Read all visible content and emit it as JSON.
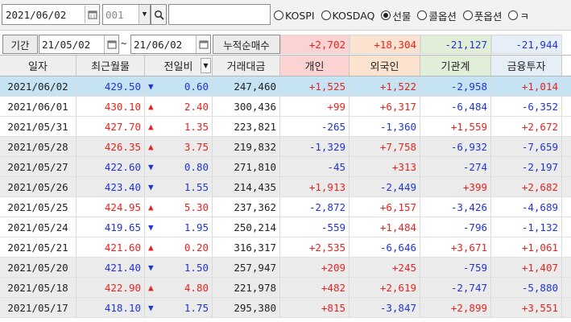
{
  "toolbar": {
    "date": "2021/06/02",
    "code": "001",
    "name": "",
    "radios": [
      {
        "label": "KOSPI",
        "selected": false
      },
      {
        "label": "KOSDAQ",
        "selected": false
      },
      {
        "label": "선물",
        "selected": true
      },
      {
        "label": "콜옵션",
        "selected": false
      },
      {
        "label": "풋옵션",
        "selected": false
      },
      {
        "label": "ㅋ",
        "selected": false
      }
    ]
  },
  "period": {
    "label": "기간",
    "from": "21/05/02",
    "tilde": "~",
    "to": "21/06/02",
    "cum_label": "누적순매수",
    "cum_values": [
      "+2,702",
      "+18,304",
      "-21,127",
      "-21,944"
    ]
  },
  "colors": {
    "up": "#e8231e",
    "down": "#1f34d8",
    "selected_row": "#c5e3f2",
    "gray_row": "#ebebeb",
    "cum_bg": [
      "#fbd3d3",
      "#fbe3cf",
      "#e2efd8",
      "#e6eef8"
    ],
    "head_bg": [
      "#eeeeee",
      "#eeeeee",
      "#eeeeee",
      "#eeeeee",
      "#fbd3d3",
      "#fbe3cf",
      "#e2efd8",
      "#e6eef8"
    ]
  },
  "icons": {
    "calendar": "calendar-icon",
    "dropdown": "chevron-down-icon",
    "search": "search-icon"
  },
  "table": {
    "headers": [
      "일자",
      "최근월물",
      "전일비",
      "거래대금",
      "개인",
      "외국인",
      "기관계",
      "금융투자"
    ],
    "rows": [
      {
        "date": "2021/06/02",
        "price": "429.50",
        "dir": "down",
        "change": "0.60",
        "amount": "247,460",
        "indiv": "+1,525",
        "foreign": "+1,522",
        "inst": "-2,958",
        "fin": "+1,014",
        "style": "selected"
      },
      {
        "date": "2021/06/01",
        "price": "430.10",
        "dir": "up",
        "change": "2.40",
        "amount": "300,436",
        "indiv": "+99",
        "foreign": "+6,317",
        "inst": "-6,484",
        "fin": "-6,352",
        "style": "white"
      },
      {
        "date": "2021/05/31",
        "price": "427.70",
        "dir": "up",
        "change": "1.35",
        "amount": "223,821",
        "indiv": "-265",
        "foreign": "-1,360",
        "inst": "+1,559",
        "fin": "+2,672",
        "style": "white"
      },
      {
        "date": "2021/05/28",
        "price": "426.35",
        "dir": "up",
        "change": "3.75",
        "amount": "219,832",
        "indiv": "-1,329",
        "foreign": "+7,758",
        "inst": "-6,932",
        "fin": "-7,659",
        "style": "gray"
      },
      {
        "date": "2021/05/27",
        "price": "422.60",
        "dir": "down",
        "change": "0.80",
        "amount": "271,810",
        "indiv": "-45",
        "foreign": "+313",
        "inst": "-274",
        "fin": "-2,197",
        "style": "gray"
      },
      {
        "date": "2021/05/26",
        "price": "423.40",
        "dir": "down",
        "change": "1.55",
        "amount": "214,435",
        "indiv": "+1,913",
        "foreign": "-2,449",
        "inst": "+399",
        "fin": "+2,682",
        "style": "gray"
      },
      {
        "date": "2021/05/25",
        "price": "424.95",
        "dir": "up",
        "change": "5.30",
        "amount": "237,362",
        "indiv": "-2,872",
        "foreign": "+6,157",
        "inst": "-3,426",
        "fin": "-4,689",
        "style": "white"
      },
      {
        "date": "2021/05/24",
        "price": "419.65",
        "dir": "down",
        "change": "1.95",
        "amount": "250,214",
        "indiv": "-559",
        "foreign": "+1,484",
        "inst": "-796",
        "fin": "-1,132",
        "style": "white"
      },
      {
        "date": "2021/05/21",
        "price": "421.60",
        "dir": "up",
        "change": "0.20",
        "amount": "316,317",
        "indiv": "+2,535",
        "foreign": "-6,646",
        "inst": "+3,671",
        "fin": "+1,061",
        "style": "white"
      },
      {
        "date": "2021/05/20",
        "price": "421.40",
        "dir": "down",
        "change": "1.50",
        "amount": "257,947",
        "indiv": "+209",
        "foreign": "+245",
        "inst": "-759",
        "fin": "+1,407",
        "style": "gray"
      },
      {
        "date": "2021/05/18",
        "price": "422.90",
        "dir": "up",
        "change": "4.80",
        "amount": "221,978",
        "indiv": "+482",
        "foreign": "+2,619",
        "inst": "-2,747",
        "fin": "-5,880",
        "style": "gray"
      },
      {
        "date": "2021/05/17",
        "price": "418.10",
        "dir": "down",
        "change": "1.75",
        "amount": "295,380",
        "indiv": "+815",
        "foreign": "-3,847",
        "inst": "+2,899",
        "fin": "+3,551",
        "style": "gray"
      }
    ]
  }
}
